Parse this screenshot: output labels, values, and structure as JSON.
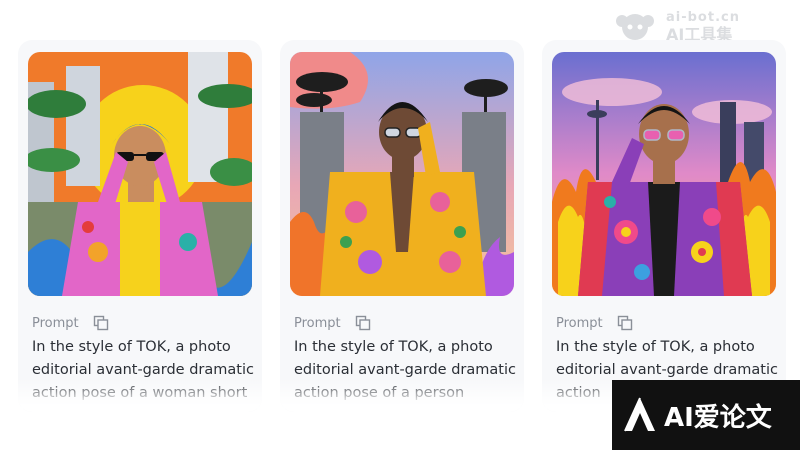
{
  "watermark_top": {
    "line1": "ai-bot.cn",
    "line2": "AI工具集"
  },
  "logo": {
    "text": "AI爱论文"
  },
  "cards": [
    {
      "prompt_label": "Prompt",
      "prompt_text": "In the style of TOK, a photo editorial avant-garde dramatic action pose of a woman short",
      "image_icon": "fashion-photo-woman-blue-hair-pink-jacket"
    },
    {
      "prompt_label": "Prompt",
      "prompt_text": "In the style of TOK, a photo editorial avant-garde dramatic action pose of a person",
      "image_icon": "fashion-photo-person-yellow-floral-jacket"
    },
    {
      "prompt_label": "Prompt",
      "prompt_text": "In the style of TOK, a photo editorial avant-garde dramatic action",
      "image_icon": "fashion-photo-man-purple-floral-jacket-flames"
    }
  ]
}
